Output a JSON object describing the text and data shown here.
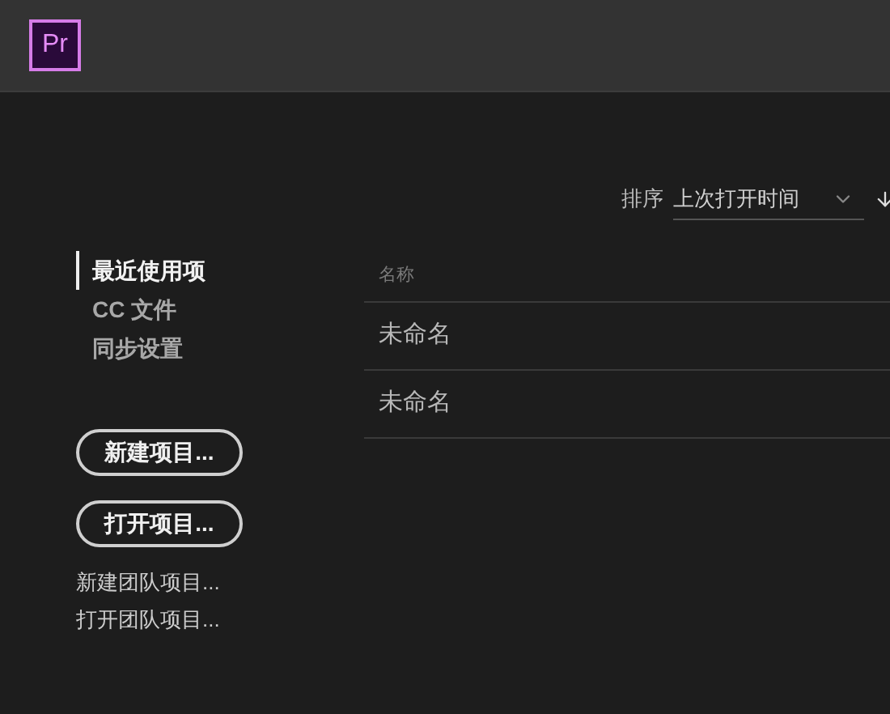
{
  "app_logo": "Pr",
  "sort": {
    "label": "排序",
    "value": "上次打开时间"
  },
  "nav": [
    {
      "label": "最近使用项",
      "selected": true
    },
    {
      "label": "CC 文件",
      "selected": false
    },
    {
      "label": "同步设置",
      "selected": false
    }
  ],
  "buttons": [
    "新建项目...",
    "打开项目..."
  ],
  "links": [
    "新建团队项目...",
    "打开团队项目..."
  ],
  "table": {
    "columns": [
      "名称"
    ],
    "rows": [
      [
        "未命名"
      ],
      [
        "未命名"
      ]
    ]
  }
}
